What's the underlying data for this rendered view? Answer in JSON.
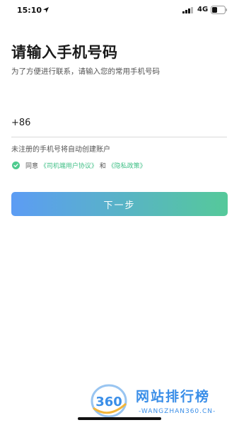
{
  "status_bar": {
    "time": "15:10",
    "network": "4G"
  },
  "header": {
    "title": "请输入手机号码",
    "subtitle": "为了方便进行联系，请输入您的常用手机号码"
  },
  "phone": {
    "country_code": "+86",
    "value": "",
    "placeholder": ""
  },
  "hint": "未注册的手机号将自动创建账户",
  "agreement": {
    "checked": true,
    "prefix": "同意",
    "link1": "《司机端用户协议》",
    "conjunction": "和",
    "link2": "《隐私政策》"
  },
  "next_button": {
    "label": "下一步"
  },
  "watermark": {
    "logo_text": "360",
    "title": "网站排行榜",
    "url": "-WANGZHAN360.CN-"
  },
  "colors": {
    "accent_green": "#4ecb8e",
    "button_gradient_start": "#5c9cf4",
    "button_gradient_end": "#55c99a",
    "watermark_blue": "#3a8ee8"
  }
}
